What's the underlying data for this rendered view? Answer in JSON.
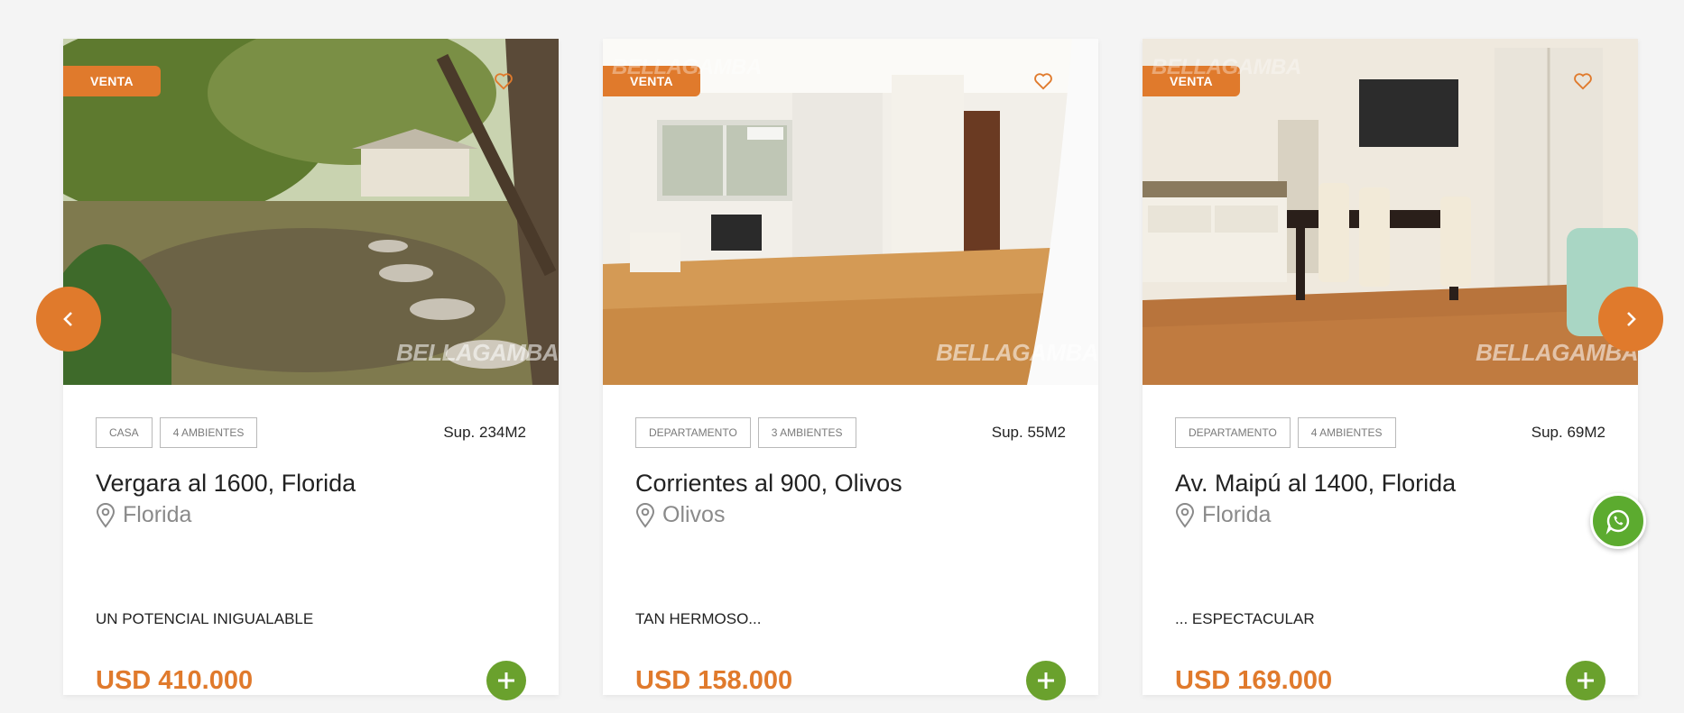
{
  "colors": {
    "accent": "#e07a2c",
    "green": "#6aa12d",
    "background": "#f4f4f4"
  },
  "carousel": {
    "prev_icon": "chevron-left-icon",
    "next_icon": "chevron-right-icon",
    "cards": [
      {
        "badge": "VENTA",
        "watermark": "BELLAGAMBA",
        "tags": [
          "CASA",
          "4 AMBIENTES"
        ],
        "surface": "Sup. 234M2",
        "title": "Vergara al 1600, Florida",
        "location": "Florida",
        "description": "UN POTENCIAL INIGUALABLE",
        "price": "USD 410.000"
      },
      {
        "badge": "VENTA",
        "watermark": "BELLAGAMBA",
        "tags": [
          "DEPARTAMENTO",
          "3 AMBIENTES"
        ],
        "surface": "Sup. 55M2",
        "title": "Corrientes al 900, Olivos",
        "location": "Olivos",
        "description": "TAN HERMOSO...",
        "price": "USD 158.000"
      },
      {
        "badge": "VENTA",
        "watermark": "BELLAGAMBA",
        "tags": [
          "DEPARTAMENTO",
          "4 AMBIENTES"
        ],
        "surface": "Sup. 69M2",
        "title": "Av. Maipú al 1400, Florida",
        "location": "Florida",
        "description": "... ESPECTACULAR",
        "price": "USD 169.000"
      }
    ]
  },
  "whatsapp_icon": "whatsapp-icon"
}
